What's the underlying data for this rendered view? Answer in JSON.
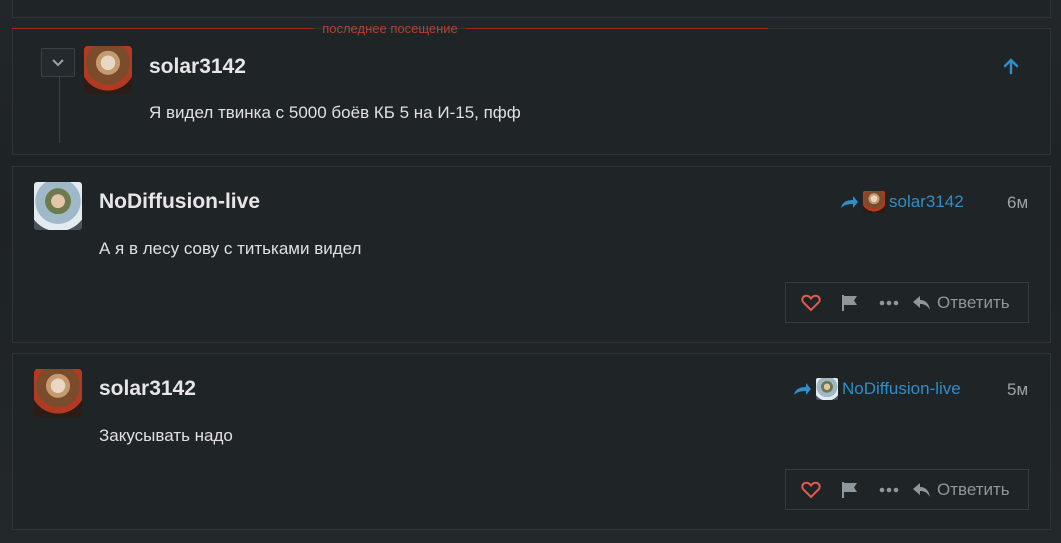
{
  "last_visit_label": "последнее посещение",
  "quoted_post": {
    "username": "solar3142",
    "text": "Я видел твинка с 5000 боёв КБ 5 на И-15, пфф"
  },
  "posts": [
    {
      "username": "NoDiffusion-live",
      "text": "А я в лесу сову с титьками видел",
      "reply_to": "solar3142",
      "time": "6м",
      "reply_label": "Ответить"
    },
    {
      "username": "solar3142",
      "text": "Закусывать надо",
      "reply_to": "NoDiffusion-live",
      "time": "5м",
      "reply_label": "Ответить"
    }
  ],
  "icons": {
    "collapse": "chevron-down-icon",
    "scroll_up": "arrow-up-icon",
    "reply_to": "reply-arrow-icon",
    "like": "heart-icon",
    "flag": "flag-icon",
    "more": "more-icon",
    "reply": "reply-icon"
  },
  "colors": {
    "accent": "#2f8ec9",
    "last_visit": "#b8402e",
    "like": "#e05a4f",
    "background": "#1f2427"
  }
}
